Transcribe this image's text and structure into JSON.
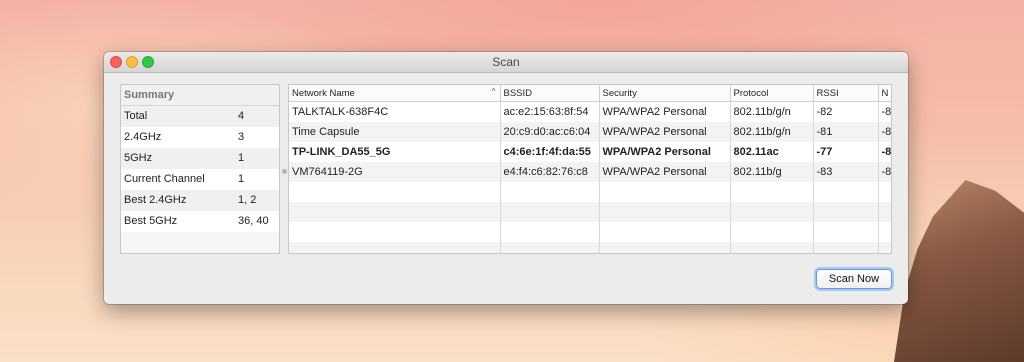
{
  "window": {
    "title": "Scan"
  },
  "summary": {
    "header": "Summary",
    "rows": [
      {
        "label": "Total",
        "value": "4"
      },
      {
        "label": "2.4GHz",
        "value": "3"
      },
      {
        "label": "5GHz",
        "value": "1"
      },
      {
        "label": "Current Channel",
        "value": "1"
      },
      {
        "label": "Best 2.4GHz",
        "value": "1, 2"
      },
      {
        "label": "Best 5GHz",
        "value": "36, 40"
      }
    ]
  },
  "table": {
    "columns": [
      "Network Name",
      "BSSID",
      "Security",
      "Protocol",
      "RSSI",
      "N"
    ],
    "sorted_column_indicator": "^",
    "rows": [
      {
        "name": "TALKTALK-638F4C",
        "bssid": "ac:e2:15:63:8f:54",
        "security": "WPA/WPA2 Personal",
        "protocol": "802.11b/g/n",
        "rssi": "-82",
        "extra": "-8"
      },
      {
        "name": "Time Capsule",
        "bssid": "20:c9:d0:ac:c6:04",
        "security": "WPA/WPA2 Personal",
        "protocol": "802.11b/g/n",
        "rssi": "-81",
        "extra": "-8"
      },
      {
        "name": "TP-LINK_DA55_5G",
        "bssid": "c4:6e:1f:4f:da:55",
        "security": "WPA/WPA2 Personal",
        "protocol": "802.11ac",
        "rssi": "-77",
        "extra": "-8"
      },
      {
        "name": "VM764119-2G",
        "bssid": "e4:f4:c6:82:76:c8",
        "security": "WPA/WPA2 Personal",
        "protocol": "802.11b/g",
        "rssi": "-83",
        "extra": "-8"
      }
    ]
  },
  "buttons": {
    "scan_now": "Scan Now"
  },
  "colors": {
    "accent": "#5b9ee8",
    "close": "#fc615d",
    "minimize": "#fdbc40",
    "maximize": "#34c84a"
  }
}
